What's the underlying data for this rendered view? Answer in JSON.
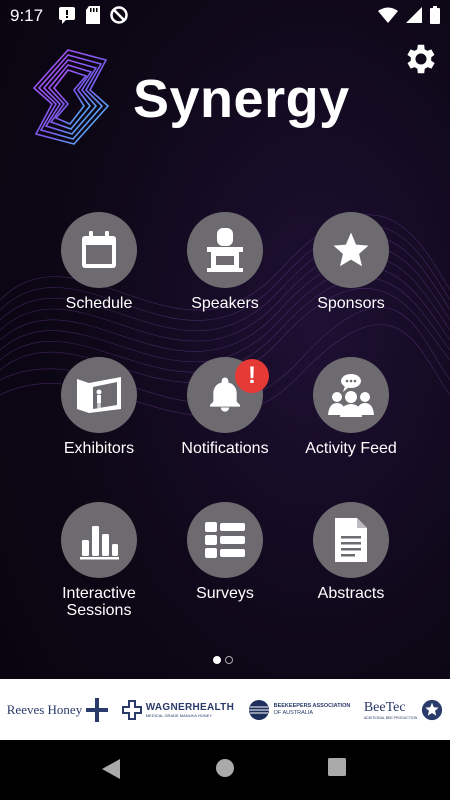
{
  "status_bar": {
    "time": "9:17",
    "left_icons": [
      "message-icon",
      "sd-card-icon",
      "do-not-disturb-icon"
    ],
    "right_icons": [
      "wifi-icon",
      "signal-icon",
      "battery-icon"
    ]
  },
  "app": {
    "brand": "Synergy",
    "settings_icon": "gear-icon",
    "accent_gradient": [
      "#a05cf0",
      "#4fc3f7"
    ]
  },
  "menu": [
    {
      "label": "Schedule",
      "icon": "calendar-icon"
    },
    {
      "label": "Speakers",
      "icon": "speaker-podium-icon"
    },
    {
      "label": "Sponsors",
      "icon": "star-icon"
    },
    {
      "label": "Exhibitors",
      "icon": "exhibitor-booth-icon"
    },
    {
      "label": "Notifications",
      "icon": "bell-icon",
      "badge": "!"
    },
    {
      "label": "Activity Feed",
      "icon": "group-chat-icon"
    },
    {
      "label": "Interactive Sessions",
      "icon": "bar-chart-icon"
    },
    {
      "label": "Surveys",
      "icon": "list-icon"
    },
    {
      "label": "Abstracts",
      "icon": "document-icon"
    }
  ],
  "pager": {
    "current": 1,
    "total": 2
  },
  "sponsors": [
    {
      "name": "Reeves Honey"
    },
    {
      "name": "WAGNERHEALTH",
      "tagline": "MEDICAL GRADE MANUKA HONEY"
    },
    {
      "name": "BEEKEEPERS ASSOCIATION",
      "tagline": "OF AUSTRALIA"
    },
    {
      "name": "BeeTec",
      "tagline": "ADDITIONAL BEE PRODUCTION"
    }
  ],
  "nav": [
    "back-icon",
    "home-icon",
    "recents-icon"
  ]
}
